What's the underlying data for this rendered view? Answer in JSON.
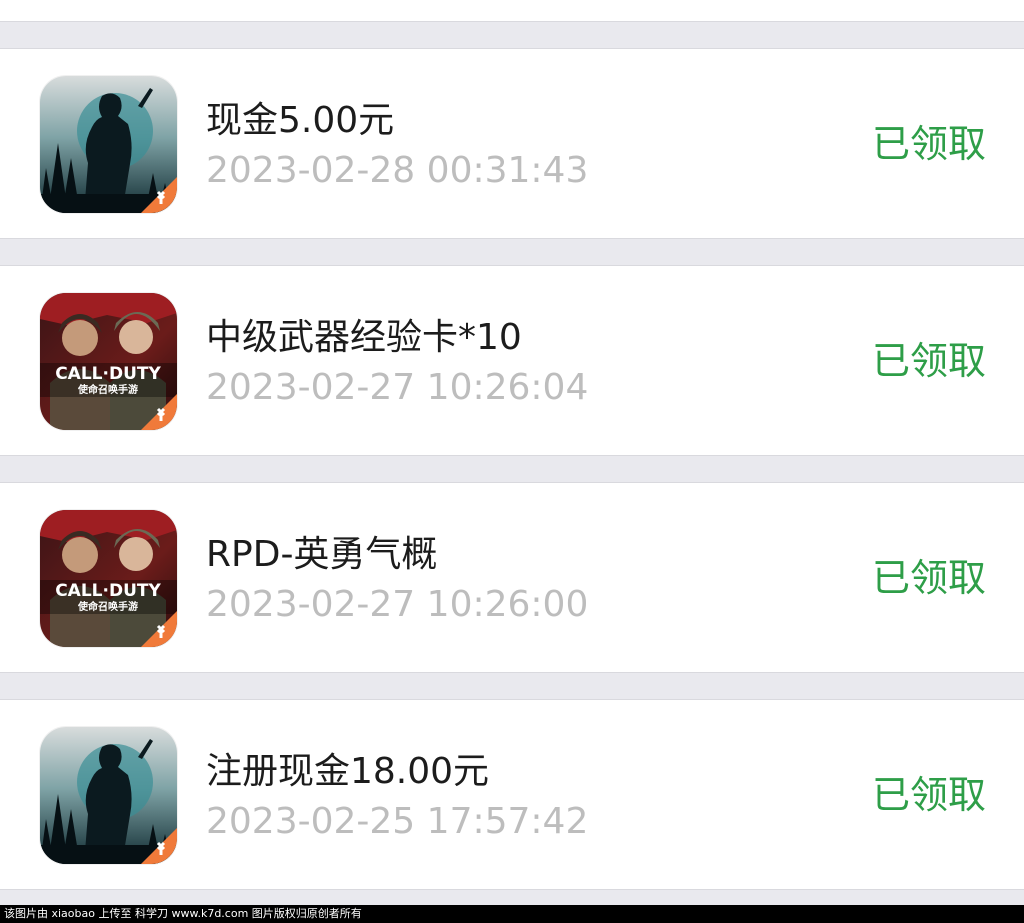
{
  "rewards": [
    {
      "icon": "survival-game-icon",
      "title": "现金5.00元",
      "time": "2023-02-28 00:31:43",
      "status": "已领取"
    },
    {
      "icon": "call-of-duty-icon",
      "title": "中级武器经验卡*10",
      "time": "2023-02-27 10:26:04",
      "status": "已领取",
      "logo_text": "CALL·DUTY",
      "logo_sub": "使命召唤手游"
    },
    {
      "icon": "call-of-duty-icon",
      "title": "RPD-英勇气概",
      "time": "2023-02-27 10:26:00",
      "status": "已领取",
      "logo_text": "CALL·DUTY",
      "logo_sub": "使命召唤手游"
    },
    {
      "icon": "survival-game-icon",
      "title": "注册现金18.00元",
      "time": "2023-02-25 17:57:42",
      "status": "已领取"
    }
  ],
  "watermark": "该图片由 xiaobao 上传至 科学刀 www.k7d.com 图片版权归原创者所有",
  "colors": {
    "status_green": "#2e9e48",
    "time_gray": "#bdbdbd",
    "separator": "#e9e9ee"
  }
}
